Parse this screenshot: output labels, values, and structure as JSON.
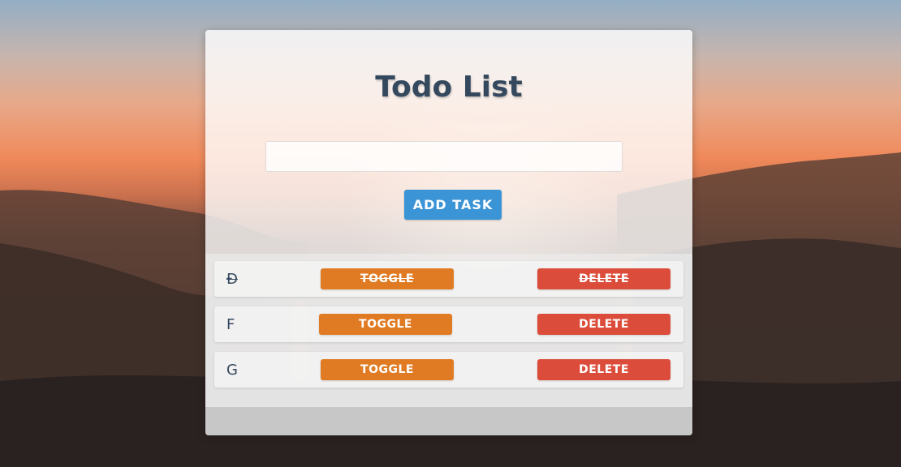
{
  "app": {
    "title": "Todo List"
  },
  "input": {
    "value": "",
    "placeholder": ""
  },
  "add_button": {
    "label": "ADD TASK"
  },
  "tasks": [
    {
      "text": "Đ",
      "completed": true,
      "toggle_label": "TOGGLE",
      "delete_label": "DELETE"
    },
    {
      "text": "F",
      "completed": false,
      "toggle_label": "TOGGLE",
      "delete_label": "DELETE"
    },
    {
      "text": "G",
      "completed": false,
      "toggle_label": "TOGGLE",
      "delete_label": "DELETE"
    }
  ],
  "colors": {
    "title": "#34495e",
    "add_button": "#3a94d6",
    "toggle_button": "#e07b24",
    "delete_button": "#dc4c3b"
  }
}
